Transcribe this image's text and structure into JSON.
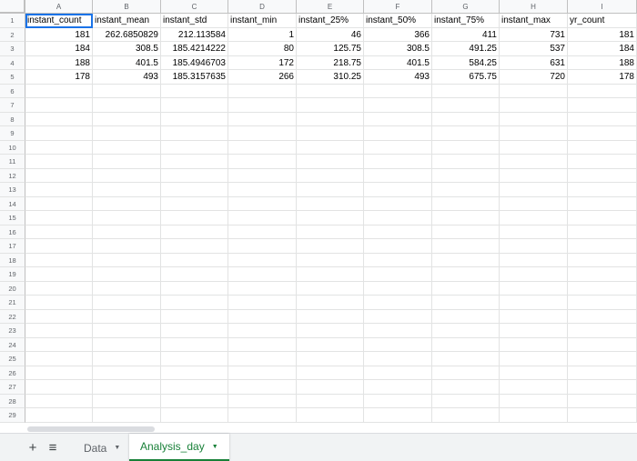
{
  "columns": [
    "A",
    "B",
    "C",
    "D",
    "E",
    "F",
    "G",
    "H",
    "I"
  ],
  "rows": [
    [
      "instant_count",
      "instant_mean",
      "instant_std",
      "instant_min",
      "instant_25%",
      "instant_50%",
      "instant_75%",
      "instant_max",
      "yr_count"
    ],
    [
      "181",
      "262.6850829",
      "212.113584",
      "1",
      "46",
      "366",
      "411",
      "731",
      "181"
    ],
    [
      "184",
      "308.5",
      "185.4214222",
      "80",
      "125.75",
      "308.5",
      "491.25",
      "537",
      "184"
    ],
    [
      "188",
      "401.5",
      "185.4946703",
      "172",
      "218.75",
      "401.5",
      "584.25",
      "631",
      "188"
    ],
    [
      "178",
      "493",
      "185.3157635",
      "266",
      "310.25",
      "493",
      "675.75",
      "720",
      "178"
    ]
  ],
  "row_numbers": [
    "1",
    "2",
    "3",
    "4",
    "5",
    "6",
    "7",
    "8",
    "9",
    "10",
    "11",
    "12",
    "13",
    "14",
    "15",
    "16",
    "17",
    "18",
    "19",
    "20",
    "21",
    "22",
    "23",
    "24",
    "25",
    "26",
    "27",
    "28",
    "29"
  ],
  "selected_cell": "A1",
  "tabbar": {
    "add_label": "+",
    "list_label": "≡",
    "sheets": [
      {
        "label": "Data",
        "active": false
      },
      {
        "label": "Analysis_day",
        "active": true
      }
    ],
    "caret": "▼"
  },
  "colors": {
    "active_tab": "#188038",
    "selection": "#1a73e8"
  }
}
